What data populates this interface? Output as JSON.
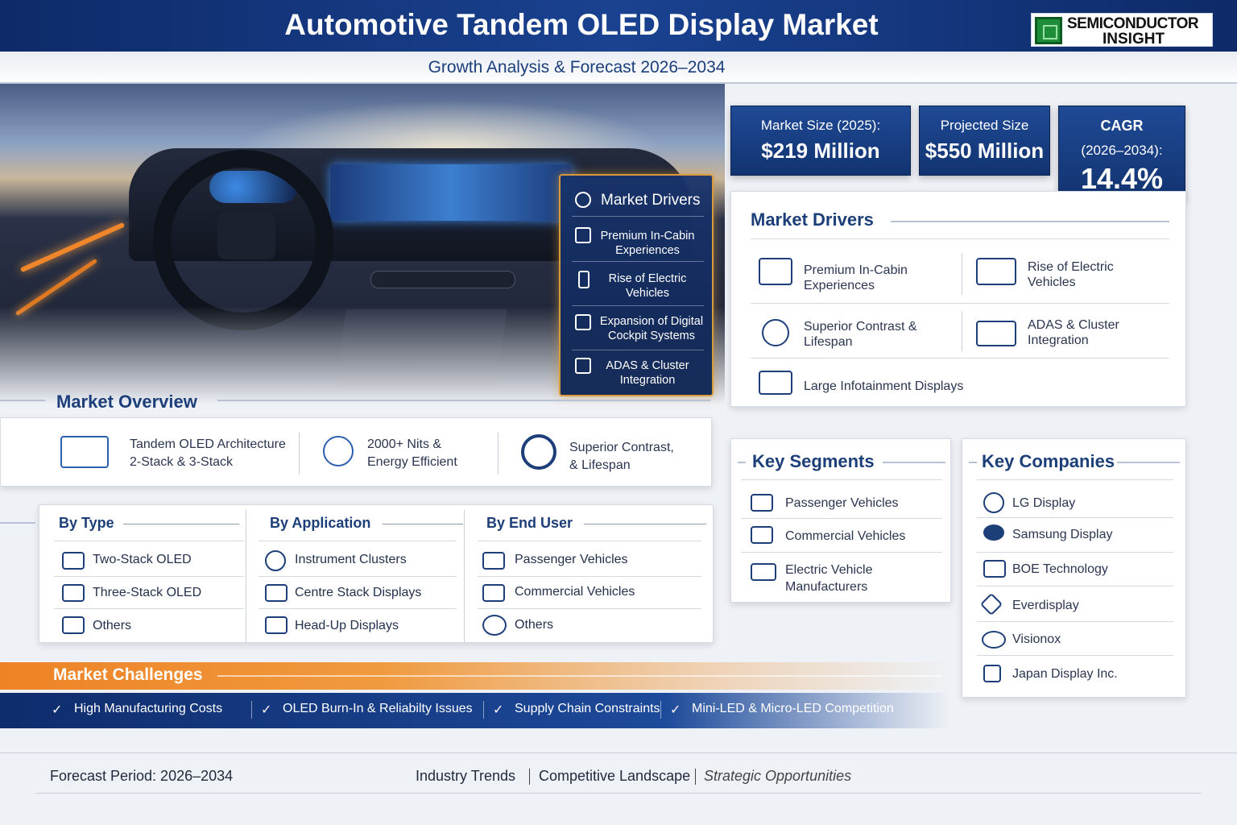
{
  "header": {
    "title": "Automotive Tandem OLED Display Market",
    "subtitle": "Growth Analysis & Forecast 2026–2034",
    "logo_line1": "SEMICONDUCTOR",
    "logo_line2": "INSIGHT"
  },
  "stats": {
    "market_size_label": "Market Size (2025):",
    "market_size_value": "$219 Million",
    "projected_label": "Projected Size",
    "projected_value": "$550 Million",
    "cagr_label": "CAGR",
    "cagr_period": "(2026–2034):",
    "cagr_value": "14.4%"
  },
  "overlay_drivers": {
    "title": "Market Drivers",
    "items": [
      {
        "label": "Premium In-Cabin Experiences",
        "icon": "display-icon"
      },
      {
        "label": "Rise of Electric Vehicles",
        "icon": "battery-icon"
      },
      {
        "label": "Expansion of Digital Cockpit Systems",
        "icon": "cockpit-icon"
      },
      {
        "label": "ADAS & Cluster Integration",
        "icon": "cluster-icon"
      }
    ]
  },
  "drivers_panel": {
    "title": "Market Drivers",
    "items": [
      {
        "label": "Premium In-Cabin Experiences",
        "icon": "car-seat-icon"
      },
      {
        "label": "Rise of Electric Vehicles",
        "icon": "electric-car-icon"
      },
      {
        "label": "Superior Contrast & Lifespan",
        "icon": "lightbulb-icon"
      },
      {
        "label": "ADAS & Cluster Integration",
        "icon": "cluster-display-icon"
      },
      {
        "label": "Large Infotainment Displays",
        "icon": "monitor-icon"
      }
    ]
  },
  "overview": {
    "title": "Market Overview",
    "items": [
      {
        "line1": "Tandem OLED Architecture",
        "line2": "2-Stack & 3-Stack",
        "icon": "stack-icon"
      },
      {
        "line1": "2000+ Nits &",
        "line2": "Energy Efficient",
        "icon": "bulb-icon"
      },
      {
        "line1": "Superior Contrast,",
        "line2": "& Lifespan",
        "icon": "hexagon-icon"
      }
    ]
  },
  "segments_table": {
    "columns": [
      {
        "title": "By Type",
        "items": [
          "Two-Stack OLED",
          "Three-Stack OLED",
          "Others"
        ]
      },
      {
        "title": "By Application",
        "items": [
          "Instrument Clusters",
          "Centre Stack Displays",
          "Head-Up Displays"
        ]
      },
      {
        "title": "By End User",
        "items": [
          "Passenger Vehicles",
          "Commercial Vehicles",
          "Others"
        ]
      }
    ]
  },
  "key_segments": {
    "title": "Key Segments",
    "items": [
      "Passenger Vehicles",
      "Commercial Vehicles",
      "Electric Vehicle Manufacturers"
    ]
  },
  "key_companies": {
    "title": "Key Companies",
    "items": [
      "LG Display",
      "Samsung Display",
      "BOE Technology",
      "Everdisplay",
      "Visionox",
      "Japan Display Inc."
    ]
  },
  "challenges": {
    "title": "Market Challenges",
    "items": [
      "High Manufacturing Costs",
      "OLED Burn-In & Reliabilty Issues",
      "Supply Chain Constraints",
      "Mini-LED & Micro-LED Competition"
    ]
  },
  "footer": {
    "forecast": "Forecast Period: 2026–2034",
    "links": [
      "Industry Trends",
      "Competitive Landscape",
      "Strategic Opportunities"
    ]
  },
  "colors": {
    "brand_navy": "#12336f",
    "accent_orange": "#ee8226",
    "gold_border": "#d79a3c"
  }
}
